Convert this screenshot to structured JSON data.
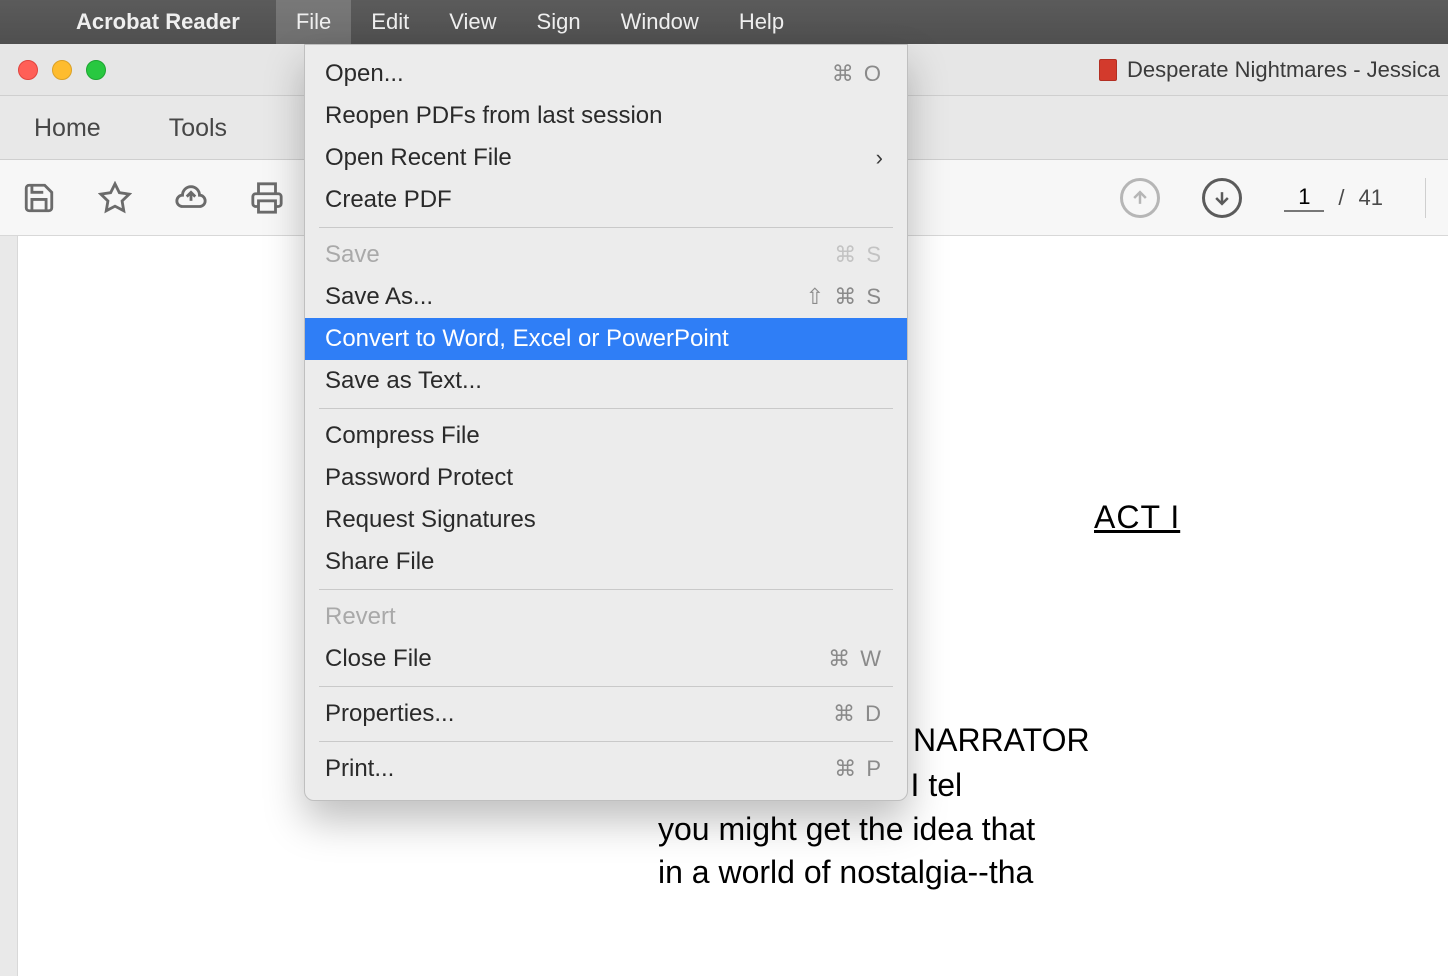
{
  "menubar": {
    "app_name": "Acrobat Reader",
    "items": [
      "File",
      "Edit",
      "View",
      "Sign",
      "Window",
      "Help"
    ],
    "active_index": 0
  },
  "window": {
    "title": "Desperate Nightmares - Jessica"
  },
  "tabs": {
    "home": "Home",
    "tools": "Tools"
  },
  "toolbar": {
    "page_current": "1",
    "page_sep": "/",
    "page_total": "41"
  },
  "file_menu": {
    "open": {
      "label": "Open...",
      "shortcut": "⌘ O"
    },
    "reopen": {
      "label": "Reopen PDFs from last session"
    },
    "open_recent": {
      "label": "Open Recent File"
    },
    "create_pdf": {
      "label": "Create PDF"
    },
    "save": {
      "label": "Save",
      "shortcut": "⌘ S"
    },
    "save_as": {
      "label": "Save As...",
      "shortcut": "⇧ ⌘ S"
    },
    "convert": {
      "label": "Convert to Word, Excel or PowerPoint"
    },
    "save_text": {
      "label": "Save as Text..."
    },
    "compress": {
      "label": "Compress File"
    },
    "password": {
      "label": "Password Protect"
    },
    "signatures": {
      "label": "Request Signatures"
    },
    "share": {
      "label": "Share File"
    },
    "revert": {
      "label": "Revert"
    },
    "close": {
      "label": "Close File",
      "shortcut": "⌘ W"
    },
    "properties": {
      "label": "Properties...",
      "shortcut": "⌘ D"
    },
    "print": {
      "label": "Print...",
      "shortcut": "⌘ P"
    }
  },
  "document": {
    "act_title": "ACT I",
    "narrator_label": "NARRATOR",
    "line1": "          ese stories I tel",
    "line2": "you might get the idea that ",
    "line3": "in a world of nostalgia--tha"
  }
}
